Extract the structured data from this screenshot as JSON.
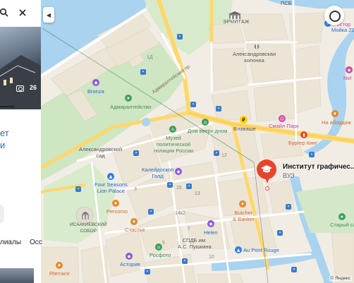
{
  "panel": {
    "photo_count": "26",
    "headline_lines": [
      "ет",
      "и"
    ],
    "tabs": [
      "лиалы",
      "Осс"
    ]
  },
  "place": {
    "title": "Институт графичес...",
    "star": "★",
    "subtitle": "ВУЗ"
  },
  "labels": {
    "pisarev": "ПСБ",
    "ermitazh": "ЭРМИТАЖ",
    "kolonna": "Александровская\nколонна",
    "moika": "Мойка 22",
    "rest_top": "Рестор",
    "admiralteystvo": "Адмиралтейство",
    "admiralteysky_pr": "Адмиралтейский пр.",
    "bronza": "Bronza",
    "muzey": "Музей\nполитической\nполиции России",
    "dom_vverh": "Дом вверх дном",
    "vlavashe": "Влаваше",
    "smail_park": "Смайл Парк",
    "na_abordazh": "На абордаж",
    "burger_king": "Бургер Кинг",
    "nol": "Nol",
    "aleksandrovsky_sad": "Александровский\nсад",
    "kaleidoskop": "Калейдоскоп\nГолд",
    "four_seasons": "Four Seasons\nLion Palace",
    "percorso": "Percorso",
    "isaakievsky": "ИСААКИЕВСКИЙ\nСОБОР",
    "schastye": "Счастье",
    "butcher": "Butcher\n& Banker",
    "helen": "Helen",
    "sgdb": "СПДБ им.\nА.С. Пушкина",
    "rosfoto": "Росфото",
    "au_pont": "Au Pont Rouge",
    "asteria": "Астория",
    "starysad": "Старый са",
    "rterrace": "Rterrace",
    "num_1d": "1Д",
    "num_14k2": "14к2",
    "num_3": "3",
    "num_7": "7",
    "num_13": "13",
    "num_12": "12",
    "num_10": "10",
    "num_15": "15",
    "num_5": "5"
  },
  "copyright": "© Яндекс",
  "colors": {
    "water": "#a9d3ef",
    "park": "#cfe6c3",
    "block": "#ece5d6",
    "road_yellow": "#ffd86b",
    "road_white": "#ffffff",
    "pin": "#e8432d",
    "link_blue": "#2b67c8"
  }
}
